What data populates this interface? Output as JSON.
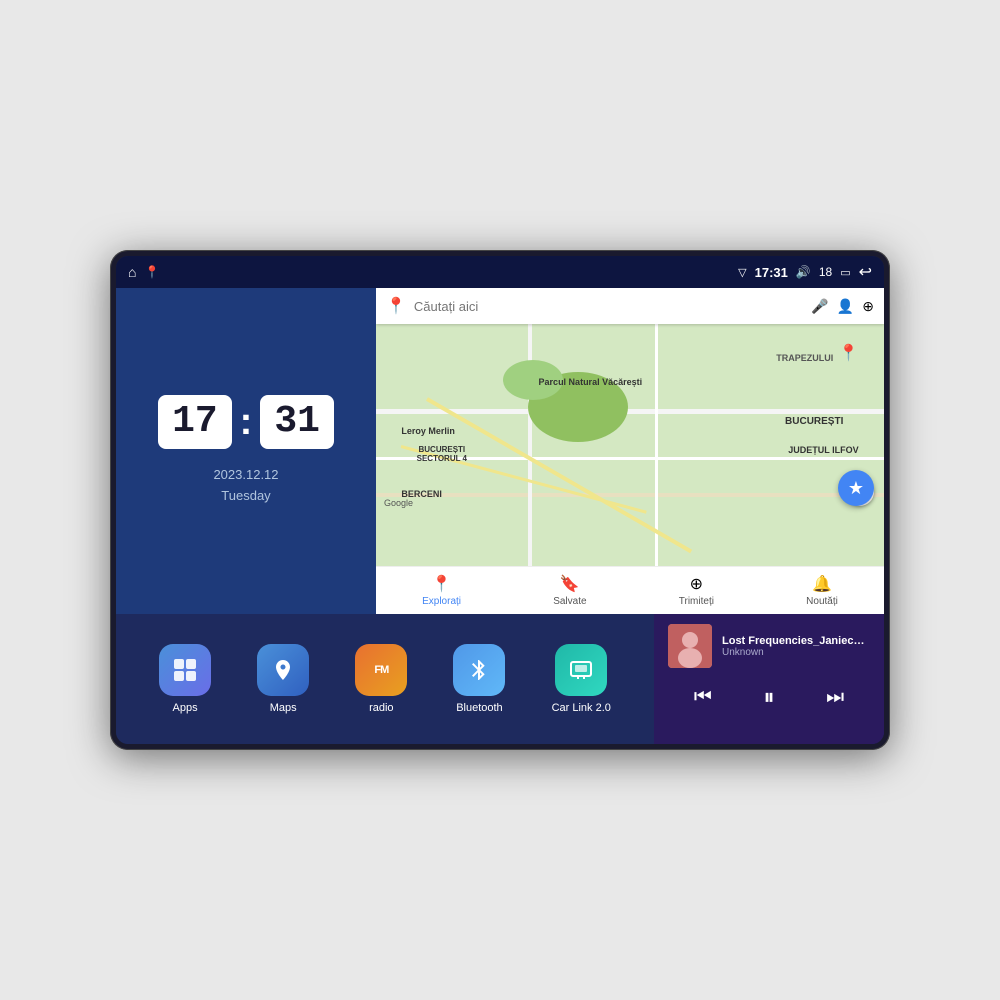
{
  "device": {
    "status_bar": {
      "left_icons": [
        "home",
        "maps"
      ],
      "signal_icon": "▽",
      "time": "17:31",
      "volume_icon": "🔊",
      "battery_level": "18",
      "battery_icon": "▭",
      "back_icon": "↩"
    },
    "clock": {
      "hours": "17",
      "minutes": "31",
      "date": "2023.12.12",
      "day": "Tuesday"
    },
    "map": {
      "search_placeholder": "Căutați aici",
      "labels": {
        "parcul": "Parcul Natural Văcărești",
        "leroy": "Leroy Merlin",
        "sector4": "BUCUREȘTI\nSECTORUL 4",
        "berceni": "BERCENI",
        "trapezului": "TRAPEZULUI",
        "bucuresti": "BUCUREȘTI",
        "ilfov": "JUDEȚUL ILFOV"
      },
      "nav_items": [
        {
          "label": "Explorați",
          "icon": "📍",
          "active": true
        },
        {
          "label": "Salvate",
          "icon": "🔖",
          "active": false
        },
        {
          "label": "Trimiteți",
          "icon": "⊕",
          "active": false
        },
        {
          "label": "Noutăți",
          "icon": "🔔",
          "active": false
        }
      ],
      "google_label": "Google"
    },
    "apps": [
      {
        "id": "apps",
        "label": "Apps",
        "icon": "⊞",
        "bg": "apps"
      },
      {
        "id": "maps",
        "label": "Maps",
        "icon": "📍",
        "bg": "maps"
      },
      {
        "id": "radio",
        "label": "radio",
        "icon": "FM",
        "bg": "radio"
      },
      {
        "id": "bluetooth",
        "label": "Bluetooth",
        "icon": "⚡",
        "bg": "bluetooth"
      },
      {
        "id": "carlink",
        "label": "Car Link 2.0",
        "icon": "📱",
        "bg": "carlink"
      }
    ],
    "music": {
      "title": "Lost Frequencies_Janieck Devy-...",
      "artist": "Unknown",
      "controls": {
        "prev": "⏮",
        "play": "⏸",
        "next": "⏭"
      }
    }
  }
}
